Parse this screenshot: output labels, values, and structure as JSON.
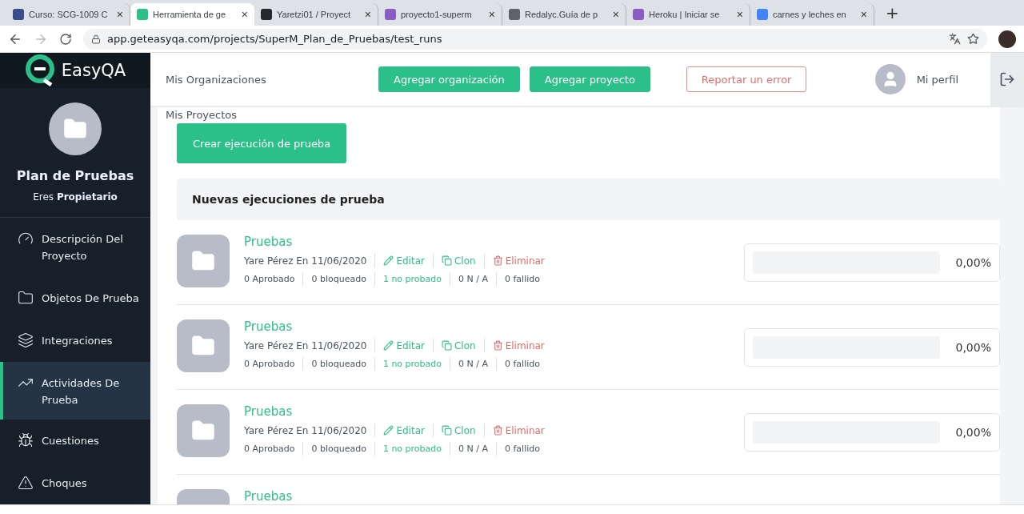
{
  "browser": {
    "tabs": [
      {
        "title": "Curso: SCG-1009 C",
        "selected": false
      },
      {
        "title": "Herramienta de ge",
        "selected": true
      },
      {
        "title": "Yaretzi01 / Proyect",
        "selected": false
      },
      {
        "title": "proyecto1-superm",
        "selected": false
      },
      {
        "title": "Redalyc.Guía de p",
        "selected": false
      },
      {
        "title": "Heroku | Iniciar se",
        "selected": false
      },
      {
        "title": "carnes y leches en",
        "selected": false
      }
    ],
    "tab_close": "×",
    "new_tab": "+",
    "url": "app.geteasyqa.com/projects/SuperM_Plan_de_Pruebas/test_runs"
  },
  "sidebar": {
    "logo": "EasyQA",
    "project_title": "Plan de Pruebas",
    "role": "Eres **Propietario**",
    "items": [
      {
        "label": "Descripción Del Proyecto",
        "selected": false
      },
      {
        "label": "Objetos De Prueba",
        "selected": false
      },
      {
        "label": "Integraciones",
        "selected": false
      },
      {
        "label": "Actividades De Prueba",
        "selected": true
      },
      {
        "label": "Cuestiones",
        "selected": false
      },
      {
        "label": "Choques",
        "selected": false
      }
    ]
  },
  "topbar": {
    "organizations": "Mis Organizaciones",
    "projects": "Mis Proyectos",
    "add_organization": "Agregar organización",
    "add_project": "Agregar proyecto",
    "report_error": "Reportar un error",
    "profile": "Mi perfil"
  },
  "content": {
    "create_button": "Crear ejecución de prueba",
    "section_title": "Nuevas ejecuciones de prueba",
    "runs": [
      {
        "name": "Pruebas",
        "meta": "Yare Pérez En 11/06/2020",
        "actions": [
          "Editar",
          "Clon",
          "Eliminar"
        ],
        "stats": [
          "0 Aprobado",
          "0 bloqueado",
          "1 no probado",
          "0 N / A",
          "0 fallido"
        ],
        "level": 0,
        "percent": "0,00%"
      },
      {
        "name": "Pruebas",
        "meta": "Yare Pérez En 11/06/2020",
        "actions": [
          "Editar",
          "Clon",
          "Eliminar"
        ],
        "stats": [
          "0 Aprobado",
          "0 bloqueado",
          "1 no probado",
          "0 N / A",
          "0 fallido"
        ],
        "level": 0,
        "percent": "0,00%"
      },
      {
        "name": "Pruebas",
        "meta": "Yare Pérez En 11/06/2020",
        "actions": [
          "Editar",
          "Clon",
          "Eliminar"
        ],
        "stats": [
          "0 Aprobado",
          "0 bloqueado",
          "1 no probado",
          "0 N / A",
          "0 fallido"
        ],
        "level": 0,
        "percent": "0,00%"
      },
      {
        "name": "Pruebas"
      }
    ]
  }
}
